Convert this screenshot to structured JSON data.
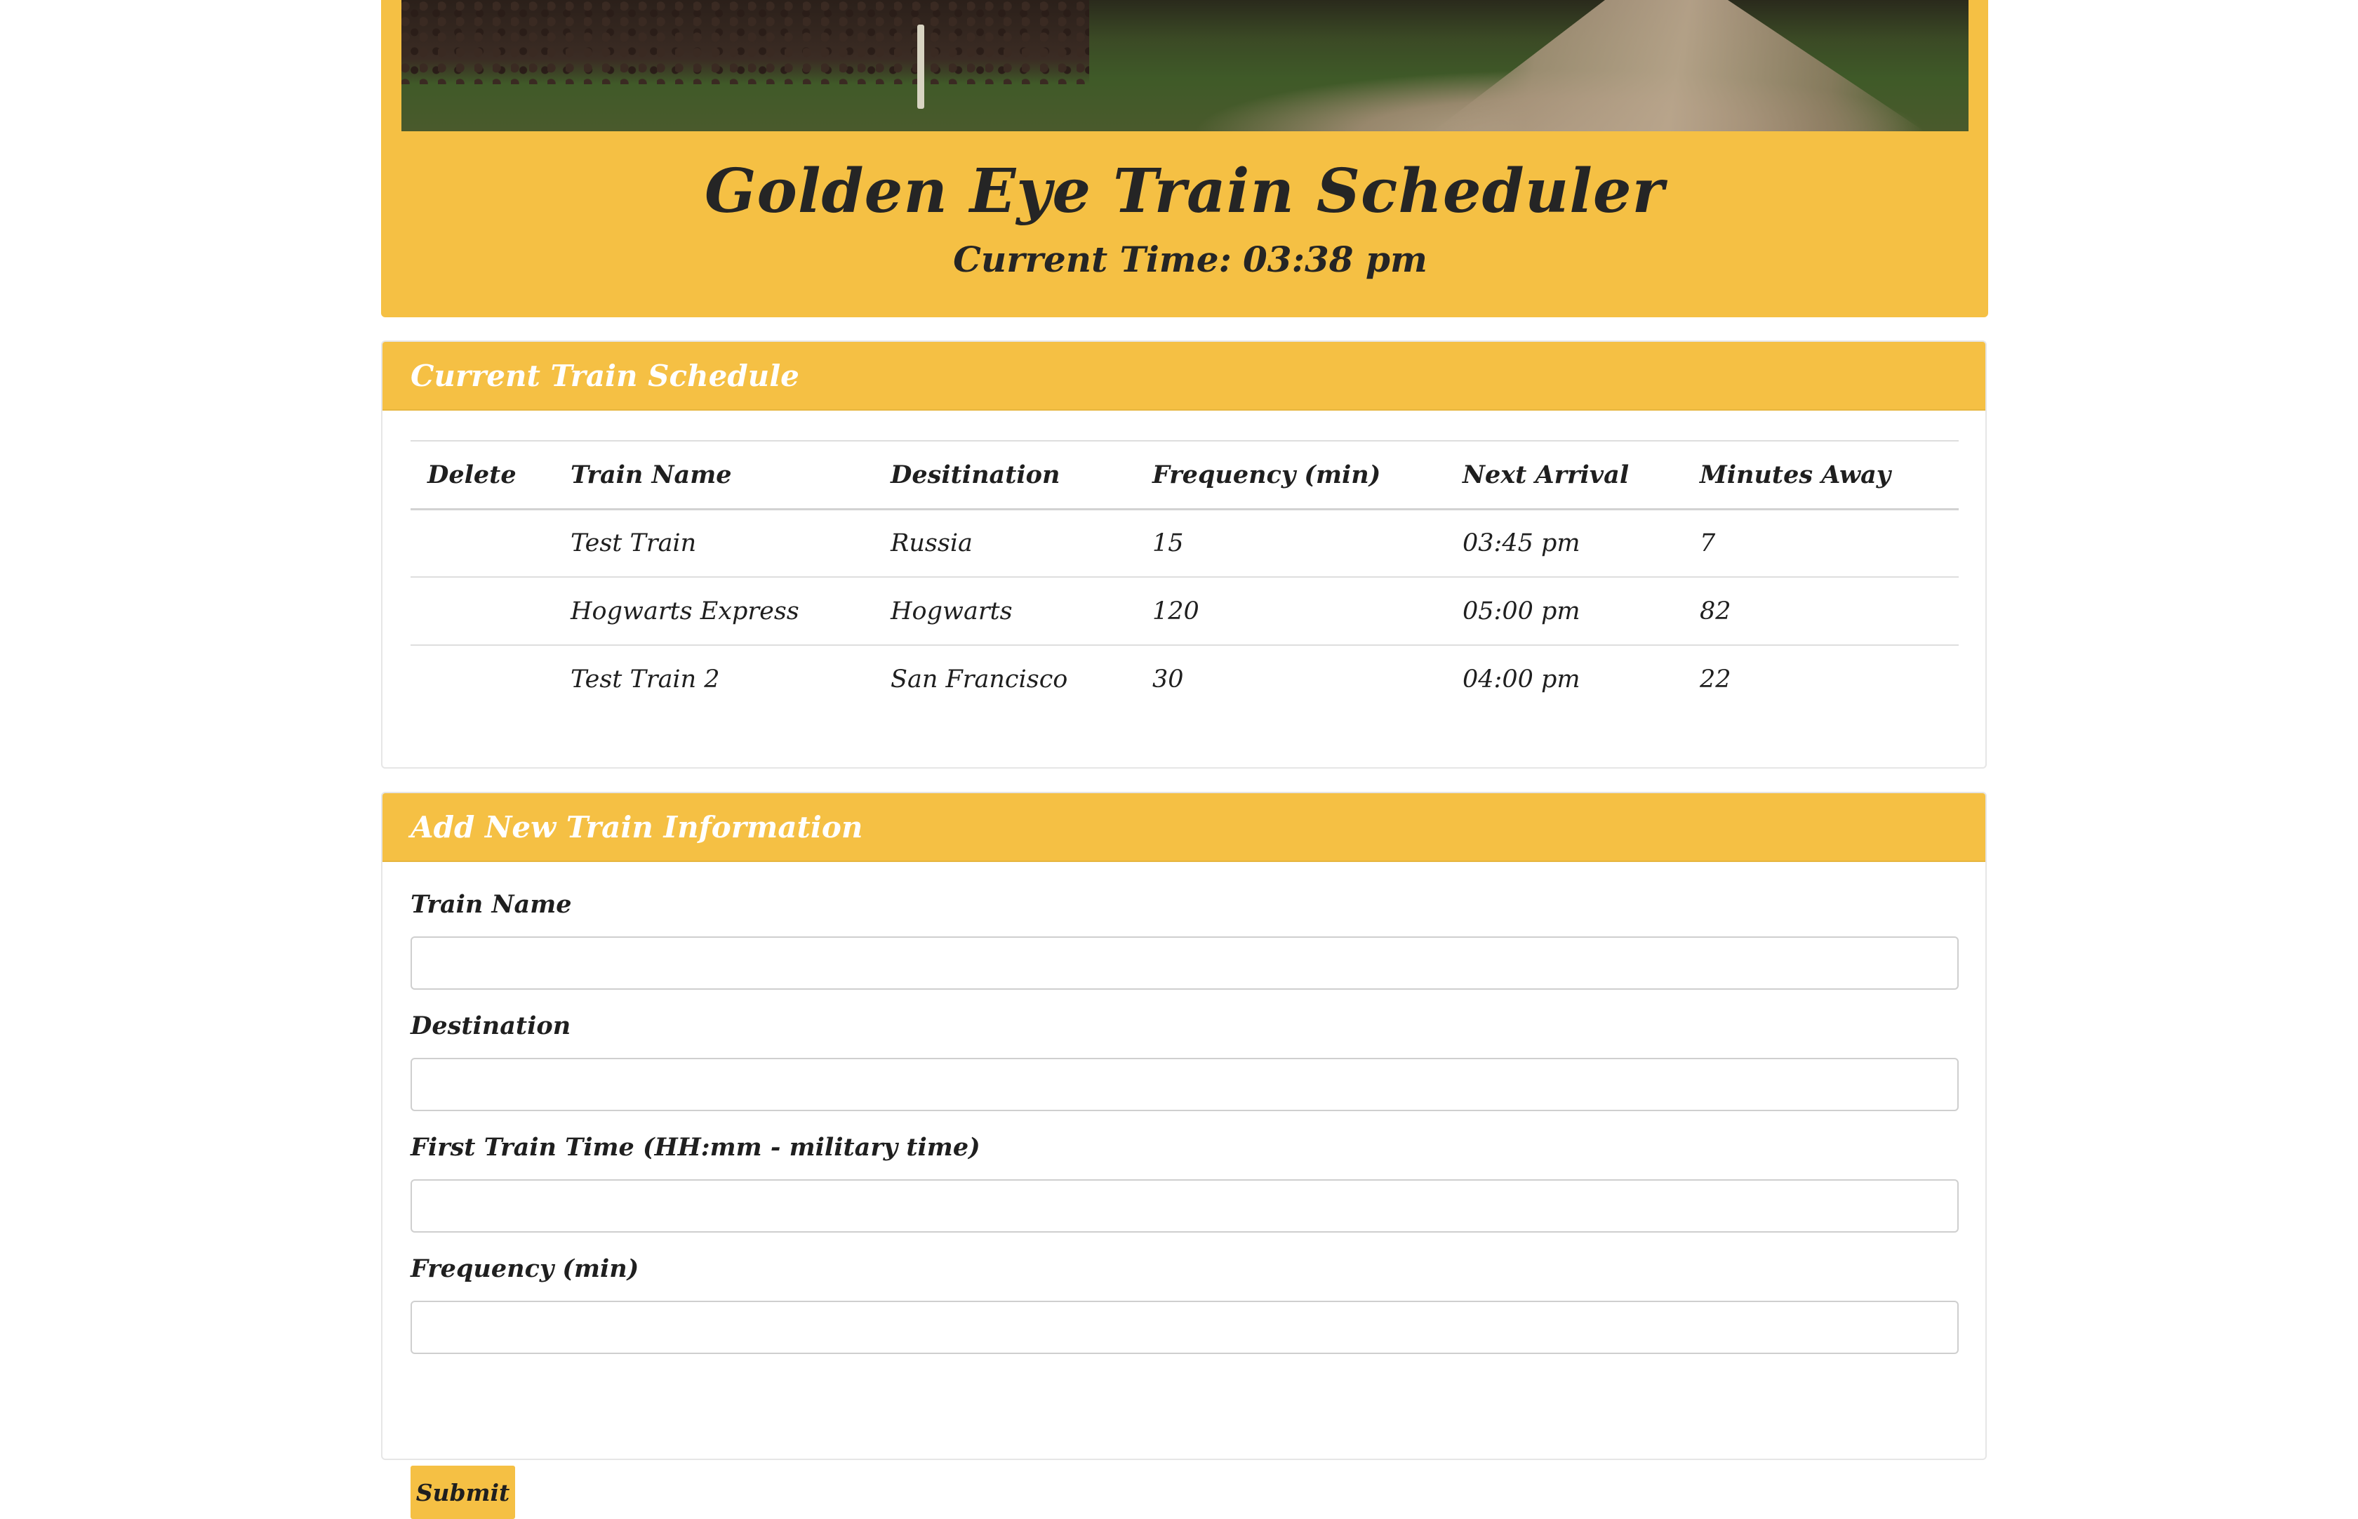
{
  "header": {
    "title": "Golden Eye Train Scheduler",
    "time_label": "Current Time:",
    "time_value": "03:38 pm"
  },
  "schedule": {
    "title": "Current Train Schedule",
    "columns": [
      "Delete",
      "Train Name",
      "Desitination",
      "Frequency (min)",
      "Next Arrival",
      "Minutes Away"
    ],
    "rows": [
      {
        "name": "Test Train",
        "destination": "Russia",
        "frequency": "15",
        "next_arrival": "03:45 pm",
        "minutes_away": "7"
      },
      {
        "name": "Hogwarts Express",
        "destination": "Hogwarts",
        "frequency": "120",
        "next_arrival": "05:00 pm",
        "minutes_away": "82"
      },
      {
        "name": "Test Train 2",
        "destination": "San Francisco",
        "frequency": "30",
        "next_arrival": "04:00 pm",
        "minutes_away": "22"
      }
    ]
  },
  "form": {
    "title": "Add New Train Information",
    "fields": [
      {
        "label": "Train Name",
        "value": ""
      },
      {
        "label": "Destination",
        "value": ""
      },
      {
        "label": "First Train Time (HH:mm - military time)",
        "value": ""
      },
      {
        "label": "Frequency (min)",
        "value": ""
      }
    ],
    "submit_label": "Submit"
  },
  "colors": {
    "accent": "#f5c044",
    "text": "#1f1f1f"
  }
}
